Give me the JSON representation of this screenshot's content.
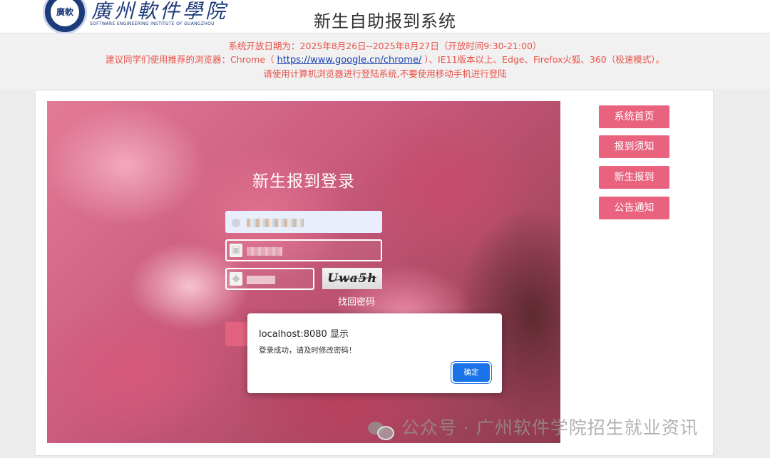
{
  "header": {
    "logo_seal_text": "廣軟",
    "logo_name": "廣州軟件學院",
    "logo_en": "SOFTWARE ENGINEERING INSTITUTE OF GUANGZHOU",
    "title": "新生自助报到系统"
  },
  "notice": {
    "line1": "系统开放日期为：2025年8月26日--2025年8月27日（开放时间9:30-21:00）",
    "line2_prefix": "建议同学们使用推荐的浏览器：Chrome（ ",
    "line2_link": "https://www.google.cn/chrome/",
    "line2_suffix": " ）、IE11版本以上、Edge、Firefox火狐、360（极速模式）。",
    "line3": "请使用计算机浏览器进行登陆系统,不要使用移动手机进行登陆"
  },
  "login": {
    "title": "新生报到登录",
    "user_icon": "user-icon",
    "lock_icon": "lock-icon",
    "shield_icon": "shield-icon",
    "captcha_text": "Uwa5h",
    "forgot_label": "找回密码"
  },
  "nav": [
    {
      "label": "系统首页"
    },
    {
      "label": "报到须知"
    },
    {
      "label": "新生报到"
    },
    {
      "label": "公告通知"
    }
  ],
  "dialog": {
    "origin": "localhost:8080 显示",
    "message": "登录成功，请及时修改密码！",
    "ok_label": "确定"
  },
  "watermark": {
    "text": "公众号 · 广州软件学院招生就业资讯"
  },
  "colors": {
    "accent_pink": "#e9637f",
    "notice_red": "#e8524a",
    "link_blue": "#1a3fb0",
    "dialog_button": "#1a73e8"
  }
}
